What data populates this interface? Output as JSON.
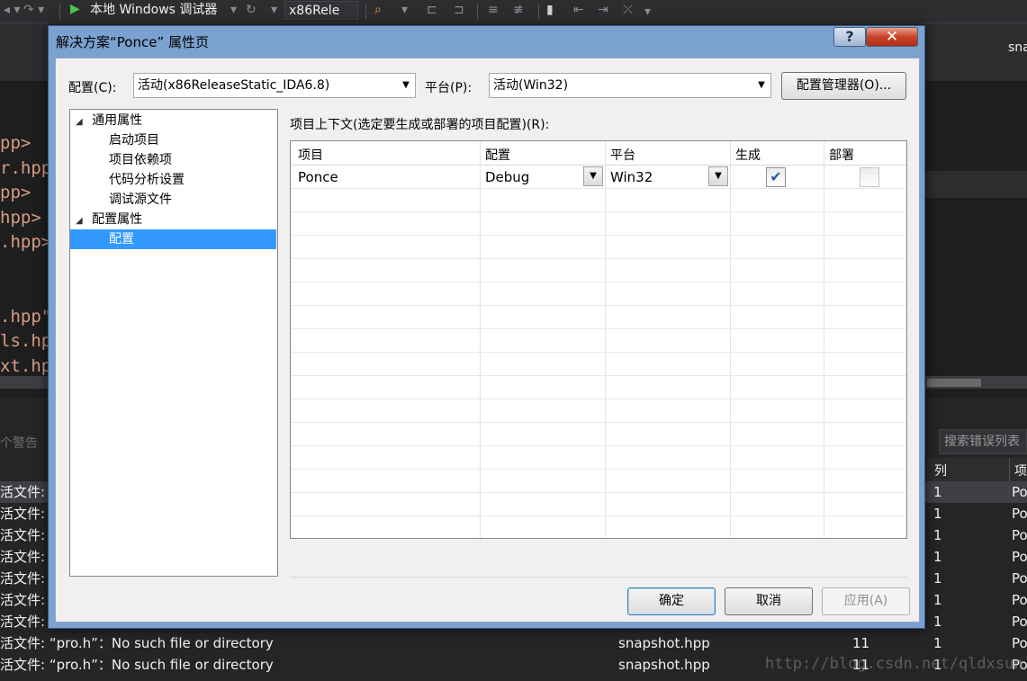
{
  "ide": {
    "toolbar": {
      "run_label": "本地 Windows 调试器",
      "config_combo": "x86Rele"
    },
    "editor_tab_partial": "sna",
    "code_lines": [
      "pp>",
      "r.hpp",
      "pp>",
      "hpp>",
      ".hpp>",
      ".hpp\"",
      "ls.hp",
      "xt.hp"
    ],
    "error_list": {
      "warnings_label": "个警告",
      "search_placeholder": "搜索错误列表",
      "col_column": "列",
      "col_project": "项",
      "rows": [
        {
          "desc": "活文件:",
          "file": "",
          "line": "",
          "col": "1",
          "proj": "Po"
        },
        {
          "desc": "活文件:",
          "file": "",
          "line": "",
          "col": "1",
          "proj": "Po"
        },
        {
          "desc": "活文件:",
          "file": "",
          "line": "",
          "col": "1",
          "proj": "Po"
        },
        {
          "desc": "活文件:",
          "file": "",
          "line": "",
          "col": "1",
          "proj": "Po"
        },
        {
          "desc": "活文件:",
          "file": "",
          "line": "",
          "col": "1",
          "proj": "Po"
        },
        {
          "desc": "活文件:",
          "file": "",
          "line": "",
          "col": "1",
          "proj": "Po"
        },
        {
          "desc": "活文件:",
          "file": "",
          "line": "",
          "col": "1",
          "proj": "Po"
        },
        {
          "desc": "活文件: “pro.h”：No such file or directory",
          "file": "snapshot.hpp",
          "line": "11",
          "col": "1",
          "proj": "Po"
        },
        {
          "desc": "活文件: “pro.h”：No such file or directory",
          "file": "snapshot.hpp",
          "line": "11",
          "col": "1",
          "proj": "Po"
        }
      ]
    },
    "watermark": "http://blog.csdn.net/qldxsun"
  },
  "dialog": {
    "title": "解决方案“Ponce” 属性页",
    "help_glyph": "?",
    "close_glyph": "✕",
    "config_label": "配置(C):",
    "config_value": "活动(x86ReleaseStatic_IDA6.8)",
    "platform_label": "平台(P):",
    "platform_value": "活动(Win32)",
    "config_manager_button": "配置管理器(O)...",
    "tree": {
      "common_props": "通用属性",
      "startup_project": "启动项目",
      "project_dependencies": "项目依赖项",
      "code_analysis": "代码分析设置",
      "debug_source": "调试源文件",
      "config_props": "配置属性",
      "configuration": "配置"
    },
    "grid_caption": "项目上下文(选定要生成或部署的项目配置)(R):",
    "grid": {
      "headers": [
        "项目",
        "配置",
        "平台",
        "生成",
        "部署"
      ],
      "row": {
        "project": "Ponce",
        "config": "Debug",
        "platform": "Win32",
        "build": true,
        "deploy": false
      }
    },
    "ok_button": "确定",
    "cancel_button": "取消",
    "apply_button": "应用(A)"
  }
}
